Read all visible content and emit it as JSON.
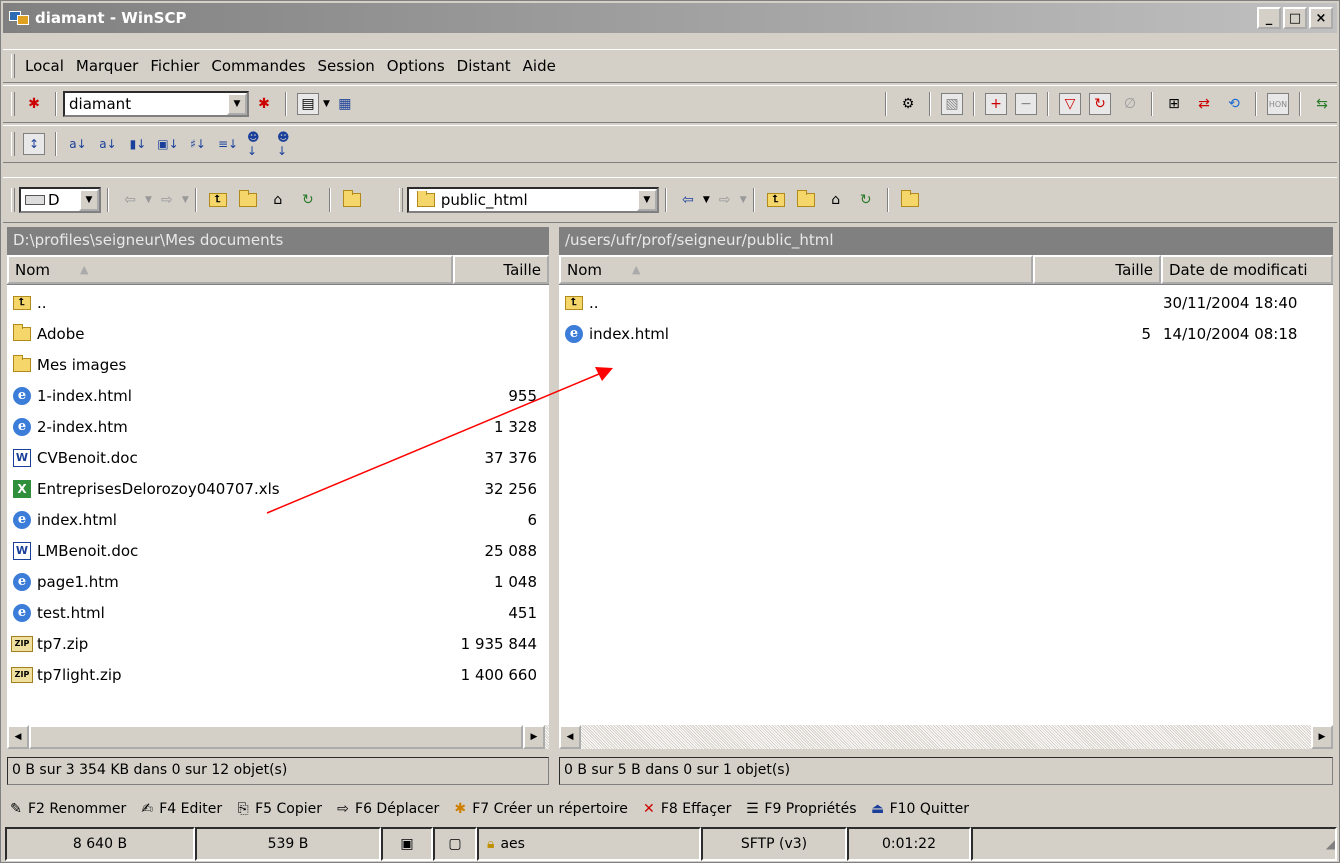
{
  "window": {
    "title": "diamant - WinSCP"
  },
  "menu": [
    "Local",
    "Marquer",
    "Fichier",
    "Commandes",
    "Session",
    "Options",
    "Distant",
    "Aide"
  ],
  "toolbar": {
    "session_combo": "diamant"
  },
  "left_panel": {
    "drive": "D",
    "path": "D:\\profiles\\seigneur\\Mes documents",
    "columns": {
      "name": "Nom",
      "size": "Taille"
    },
    "files": [
      {
        "name": "..",
        "size": "",
        "type": "up"
      },
      {
        "name": "Adobe",
        "size": "",
        "type": "folder"
      },
      {
        "name": "Mes images",
        "size": "",
        "type": "folder"
      },
      {
        "name": "1-index.html",
        "size": "955",
        "type": "ie"
      },
      {
        "name": "2-index.htm",
        "size": "1 328",
        "type": "ie"
      },
      {
        "name": "CVBenoit.doc",
        "size": "37 376",
        "type": "doc"
      },
      {
        "name": "EntreprisesDelorozoy040707.xls",
        "size": "32 256",
        "type": "xls"
      },
      {
        "name": "index.html",
        "size": "6",
        "type": "ie"
      },
      {
        "name": "LMBenoit.doc",
        "size": "25 088",
        "type": "doc"
      },
      {
        "name": "page1.htm",
        "size": "1 048",
        "type": "ie"
      },
      {
        "name": "test.html",
        "size": "451",
        "type": "ie"
      },
      {
        "name": "tp7.zip",
        "size": "1 935 844",
        "type": "zip"
      },
      {
        "name": "tp7light.zip",
        "size": "1 400 660",
        "type": "zip"
      }
    ],
    "status": "0 B sur 3 354 KB dans 0 sur 12 objet(s)"
  },
  "right_panel": {
    "folder": "public_html",
    "path": "/users/ufr/prof/seigneur/public_html",
    "columns": {
      "name": "Nom",
      "size": "Taille",
      "date": "Date de modificati"
    },
    "files": [
      {
        "name": "..",
        "size": "",
        "date": "30/11/2004 18:40",
        "type": "up"
      },
      {
        "name": "index.html",
        "size": "5",
        "date": "14/10/2004 08:18",
        "type": "ie"
      }
    ],
    "status": "0 B sur 5 B dans 0 sur 1 objet(s)"
  },
  "fkeys": [
    {
      "label": "F2 Renommer",
      "icon": "rename-icon"
    },
    {
      "label": "F4 Editer",
      "icon": "edit-icon"
    },
    {
      "label": "F5 Copier",
      "icon": "copy-icon"
    },
    {
      "label": "F6 Déplacer",
      "icon": "move-icon"
    },
    {
      "label": "F7 Créer un répertoire",
      "icon": "new-folder-icon"
    },
    {
      "label": "F8 Effaçer",
      "icon": "delete-icon"
    },
    {
      "label": "F9 Propriétés",
      "icon": "properties-icon"
    },
    {
      "label": "F10 Quitter",
      "icon": "quit-icon"
    }
  ],
  "statusbar": {
    "bytes_sent": "8 640 B",
    "bytes_received": "539 B",
    "cipher": "aes",
    "protocol": "SFTP (v3)",
    "elapsed": "0:01:22"
  },
  "colors": {
    "annotation_arrow": "#ff0000",
    "path_bar": "#808080"
  }
}
